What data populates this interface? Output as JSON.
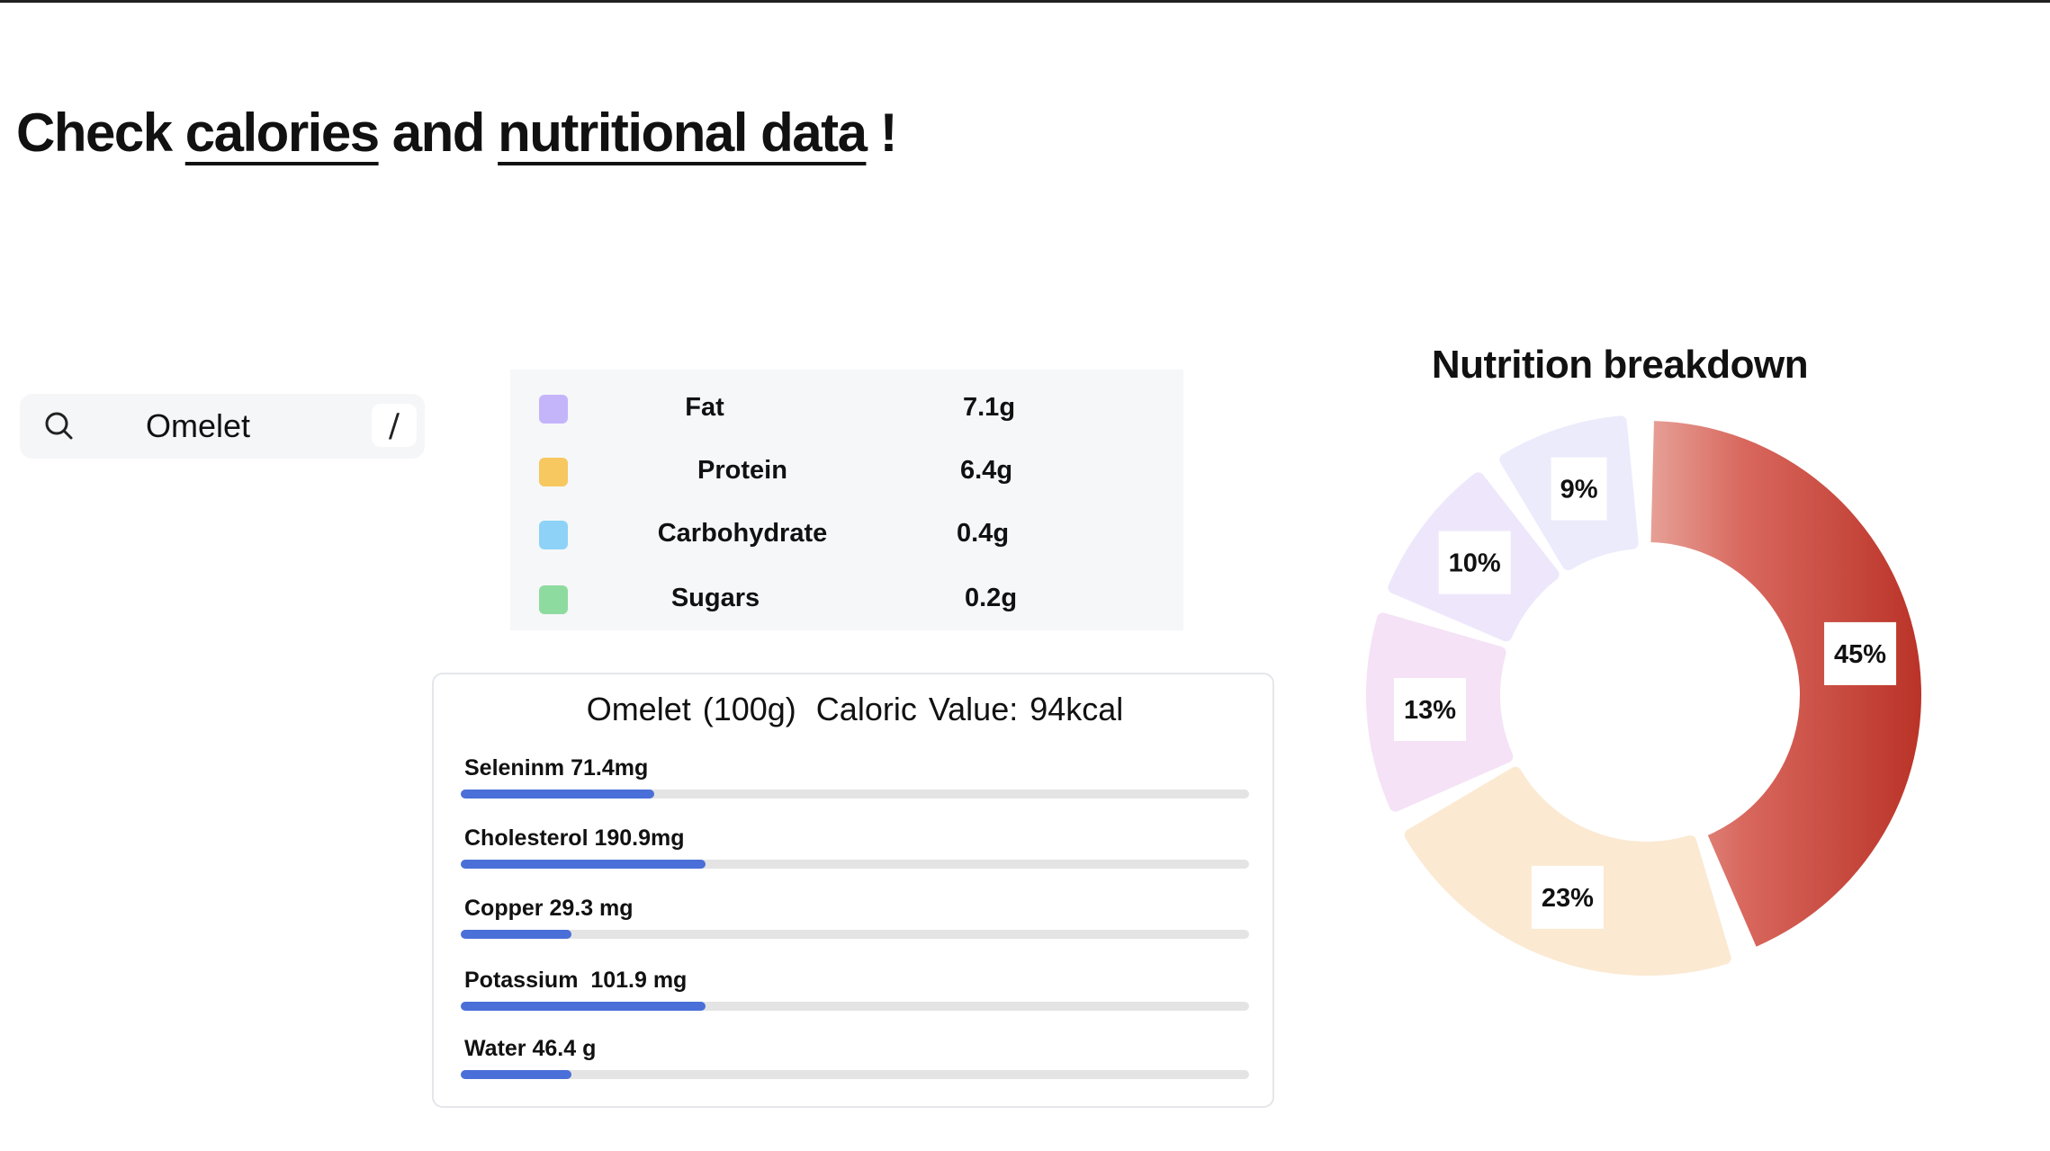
{
  "headline": {
    "part1": "Check ",
    "link1": "calories",
    "part2": " and ",
    "link2": "nutritional data",
    "part3": " !"
  },
  "search": {
    "value": "Omelet",
    "placeholder": "",
    "shortcut": "/",
    "icon": "search-icon"
  },
  "macros": [
    {
      "name": "Fat",
      "value": "7.1g",
      "color": "#c4b5fb"
    },
    {
      "name": "Protein",
      "value": "6.4g",
      "color": "#f6c85f"
    },
    {
      "name": "Carbohydrate",
      "value": "0.4g",
      "color": "#8ed3f7"
    },
    {
      "name": "Sugars",
      "value": "0.2g",
      "color": "#8edb9f"
    }
  ],
  "details": {
    "food": "Omelet (100g)",
    "calories": "Caloric Value: 94kcal",
    "nutrients": [
      {
        "label": "Seleninm 71.4mg",
        "fraction": 0.245
      },
      {
        "label": "Cholesterol 190.9mg",
        "fraction": 0.31
      },
      {
        "label": "Copper 29.3 mg",
        "fraction": 0.14
      },
      {
        "label": "Potassium  101.9 mg",
        "fraction": 0.31
      },
      {
        "label": "Water 46.4 g",
        "fraction": 0.14
      }
    ],
    "bar_color": "#4a6fd8"
  },
  "breakdown": {
    "title": "Nutrition breakdown"
  },
  "chart_data": {
    "type": "pie",
    "title": "Nutrition breakdown",
    "categories": [
      "",
      "",
      "",
      "",
      ""
    ],
    "values": [
      45,
      23,
      13,
      10,
      9
    ],
    "labels": [
      "45%",
      "23%",
      "13%",
      "10%",
      "9%"
    ],
    "colors": [
      "#c8403a",
      "#fbe9d2",
      "#f5e2f6",
      "#eee7fb",
      "#ebebfc"
    ],
    "legend": "none"
  }
}
